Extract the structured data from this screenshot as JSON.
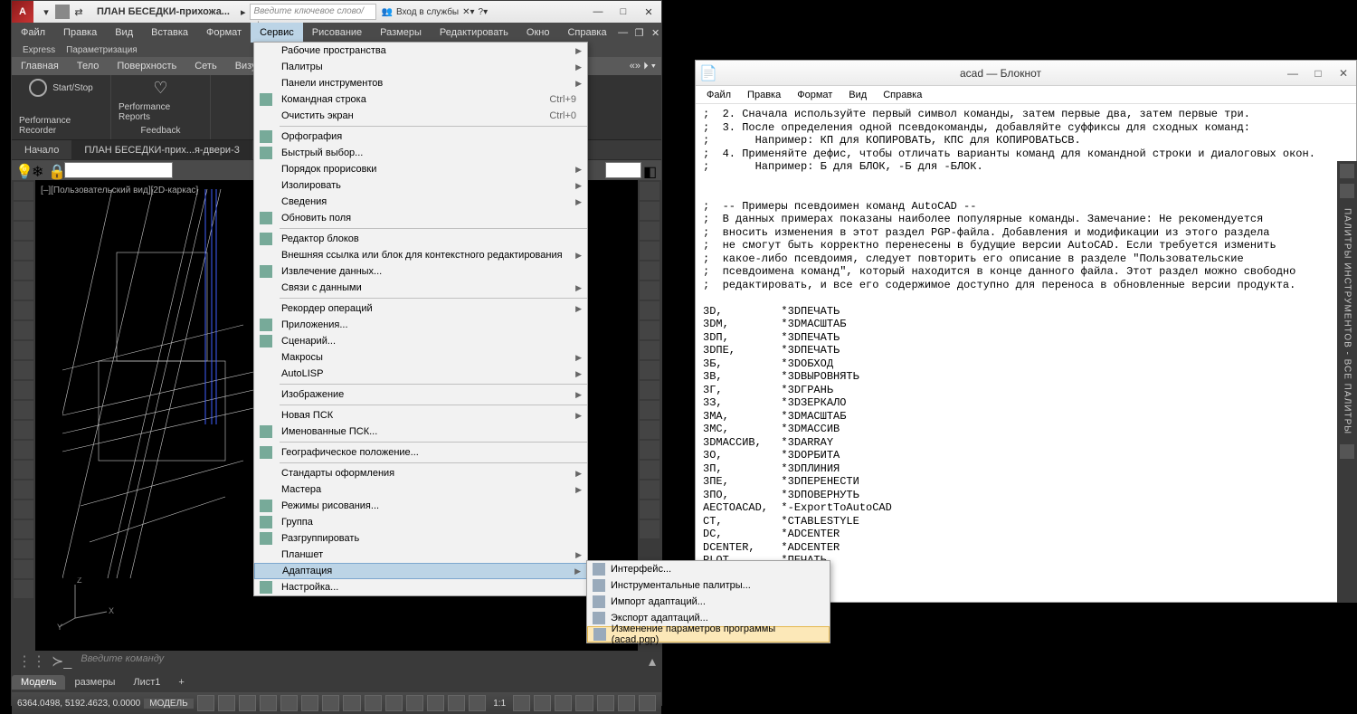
{
  "acad": {
    "title": "ПЛАН БЕСЕДКИ-прихожа...",
    "searchPlaceholder": "Введите ключевое слово/фразу",
    "login": "Вход в службы",
    "menubar": [
      "Файл",
      "Правка",
      "Вид",
      "Вставка",
      "Формат",
      "Сервис",
      "Рисование",
      "Размеры",
      "Редактировать",
      "Окно",
      "Справка"
    ],
    "express": [
      "Express",
      "Параметризация"
    ],
    "ribbonTabs": [
      "Главная",
      "Тело",
      "Поверхность",
      "Сеть",
      "Визуализация"
    ],
    "ribbonStartStop": "Start/Stop",
    "ribbonPerfReports": "Performance Reports",
    "ribbonPerfRec": "Performance Recorder",
    "ribbonFeedback": "Feedback",
    "docTabs": [
      "Начало",
      "ПЛАН БЕСЕДКИ-прих...я-двери-3"
    ],
    "vpLabel": "[–][Пользовательский вид][2D-каркас]",
    "cmdPlaceholder": "Введите команду",
    "layoutTabs": [
      "Модель",
      "размеры",
      "Лист1",
      "+"
    ],
    "coords": "6364.0498, 5192.4623, 0.0000",
    "model": "МОДЕЛЬ",
    "scale": "1:1"
  },
  "serviceMenu": [
    {
      "t": "Рабочие пространства",
      "sub": true
    },
    {
      "t": "Палитры",
      "sub": true
    },
    {
      "t": "Панели инструментов",
      "sub": true
    },
    {
      "t": "Командная строка",
      "sc": "Ctrl+9",
      "icon": true
    },
    {
      "t": "Очистить экран",
      "sc": "Ctrl+0"
    },
    {
      "sep": true
    },
    {
      "t": "Орфография",
      "icon": true
    },
    {
      "t": "Быстрый выбор...",
      "icon": true
    },
    {
      "t": "Порядок прорисовки",
      "sub": true
    },
    {
      "t": "Изолировать",
      "sub": true
    },
    {
      "t": "Сведения",
      "sub": true
    },
    {
      "t": "Обновить поля",
      "icon": true
    },
    {
      "sep": true
    },
    {
      "t": "Редактор блоков",
      "icon": true
    },
    {
      "t": "Внешняя ссылка или блок для контекстного редактирования",
      "sub": true
    },
    {
      "t": "Извлечение данных...",
      "icon": true
    },
    {
      "t": "Связи с данными",
      "sub": true
    },
    {
      "sep": true
    },
    {
      "t": "Рекордер операций",
      "sub": true
    },
    {
      "t": "Приложения...",
      "icon": true
    },
    {
      "t": "Сценарий...",
      "icon": true
    },
    {
      "t": "Макросы",
      "sub": true
    },
    {
      "t": "AutoLISP",
      "sub": true
    },
    {
      "sep": true
    },
    {
      "t": "Изображение",
      "sub": true
    },
    {
      "sep": true
    },
    {
      "t": "Новая ПСК",
      "sub": true
    },
    {
      "t": "Именованные ПСК...",
      "icon": true
    },
    {
      "sep": true
    },
    {
      "t": "Географическое положение...",
      "icon": true
    },
    {
      "sep": true
    },
    {
      "t": "Стандарты оформления",
      "sub": true
    },
    {
      "t": "Мастера",
      "sub": true
    },
    {
      "t": "Режимы рисования...",
      "icon": true
    },
    {
      "t": "Группа",
      "icon": true
    },
    {
      "t": "Разгруппировать",
      "icon": true
    },
    {
      "t": "Планшет",
      "sub": true
    },
    {
      "t": "Адаптация",
      "sub": true,
      "hi": true
    },
    {
      "t": "Настройка...",
      "icon": true
    }
  ],
  "submenu": [
    {
      "t": "Интерфейс...",
      "icon": true
    },
    {
      "t": "Инструментальные палитры...",
      "icon": true
    },
    {
      "sep": true
    },
    {
      "t": "Импорт адаптаций...",
      "icon": true
    },
    {
      "t": "Экспорт адаптаций...",
      "icon": true
    },
    {
      "sep": true
    },
    {
      "t": "Изменение параметров программы (acad.pgp)",
      "icon": true,
      "hi": true
    }
  ],
  "notepad": {
    "title": "acad — Блокнот",
    "menu": [
      "Файл",
      "Правка",
      "Формат",
      "Вид",
      "Справка"
    ],
    "content": ";  2. Сначала используйте первый символ команды, затем первые два, затем первые три.\n;  3. После определения одной псевдокоманды, добавляйте суффиксы для сходных команд:\n;       Например: КП для КОПИРОВАТЬ, КПС для КОПИРОВАТЬСВ.\n;  4. Применяйте дефис, чтобы отличать варианты команд для командной строки и диалоговых окон.\n;       Например: Б для БЛОК, -Б для -БЛОК.\n\n\n;  -- Примеры псевдоимен команд AutoCAD --\n;  В данных примерах показаны наиболее популярные команды. Замечание: Не рекомендуется\n;  вносить изменения в этот раздел PGP-файла. Добавления и модификации из этого раздела\n;  не смогут быть корректно перенесены в будущие версии AutoCAD. Если требуется изменить\n;  какое-либо псевдоимя, следует повторить его описание в разделе \"Пользовательские\n;  псевдоимена команд\", который находится в конце данного файла. Этот раздел можно свободно\n;  редактировать, и все его содержимое доступно для переноса в обновленные версии продукта.\n\n3D,         *3DПЕЧАТЬ\n3DM,        *3DМАСШТАБ\n3DП,        *3DПЕЧАТЬ\n3DПЕ,       *3DПЕЧАТЬ\n3Б,         *3DОБХОД\n3В,         *3DВЫРОВНЯТЬ\n3Г,         *3DГРАНЬ\n3З,         *3DЗЕРКАЛО\n3МА,        *3DМАСШТАБ\n3МС,        *3DМАССИВ\n3DМАССИВ,   *3DARRAY\n3О,         *3DОРБИТА\n3П,         *3DПЛИНИЯ\n3ПЕ,        *3DПЕРЕНЕСТИ\n3ПО,        *3DПОВЕРНУТЬ\nAECTOACAD,  *-ExportToAutoCAD\nCT,         *CTABLESTYLE\nDC,         *ADCENTER\nDCENTER,    *ADCENTER\nPLOT,       *ПЕЧАТЬ"
  },
  "paletteLabel": "ПАЛИТРЫ ИНСТРУМЕНТОВ - ВСЕ ПАЛИТРЫ"
}
